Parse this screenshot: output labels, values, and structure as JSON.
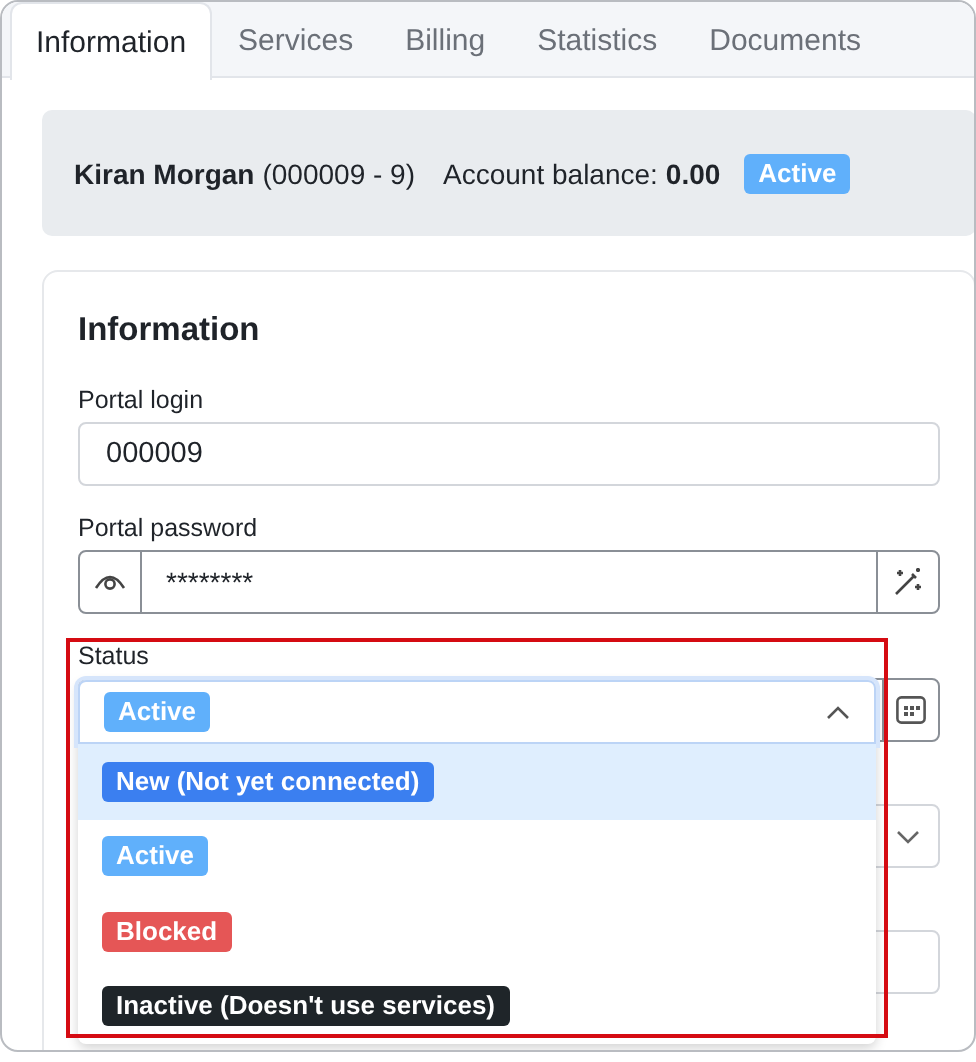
{
  "tabs": [
    {
      "label": "Information",
      "selected": true
    },
    {
      "label": "Services",
      "selected": false
    },
    {
      "label": "Billing",
      "selected": false
    },
    {
      "label": "Statistics",
      "selected": false
    },
    {
      "label": "Documents",
      "selected": false
    }
  ],
  "summary": {
    "name": "Kiran Morgan",
    "id": "(000009 - 9)",
    "balance_label": "Account balance:",
    "balance": "0.00",
    "status": {
      "label": "Active",
      "color": "#60b0fb"
    }
  },
  "section": {
    "title": "Information",
    "fields": [
      {
        "kind": "text",
        "label": "Portal login",
        "value": "000009"
      },
      {
        "kind": "password",
        "label": "Portal password",
        "value": "********"
      }
    ],
    "status": {
      "label": "Status",
      "value": {
        "label": "Active",
        "color": "#60b0fb"
      },
      "expanded": true,
      "options": [
        {
          "label": "New (Not yet connected)",
          "color": "#3b7ff0",
          "highlighted": true
        },
        {
          "label": "Active",
          "color": "#60b0fb",
          "highlighted": false
        },
        {
          "label": "Blocked",
          "color": "#e55656",
          "highlighted": false
        },
        {
          "label": "Inactive (Doesn't use services)",
          "color": "#1f2529",
          "highlighted": false
        }
      ]
    }
  }
}
